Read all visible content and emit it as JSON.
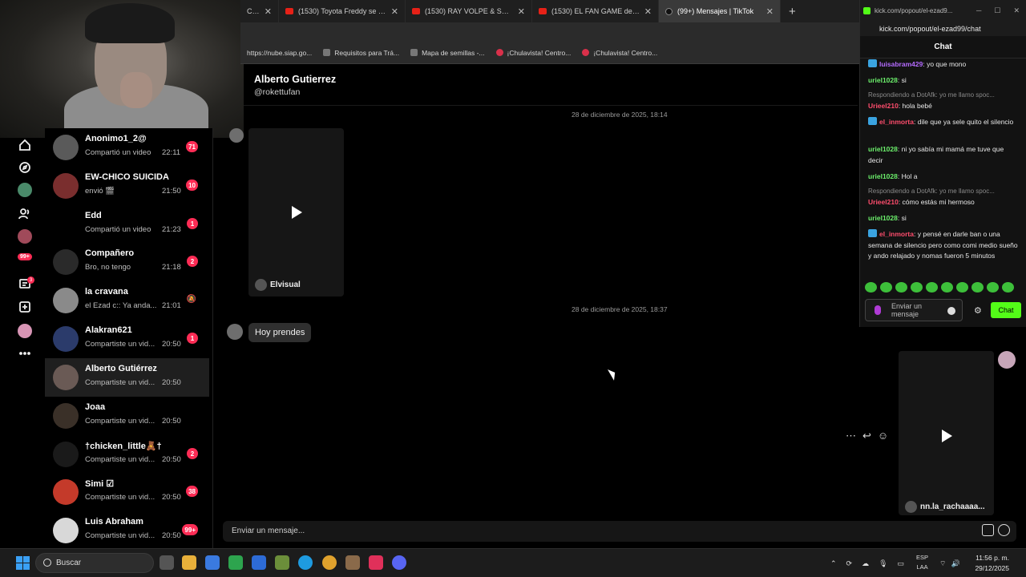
{
  "browser": {
    "tabs": [
      {
        "label": "C, B",
        "icon": "generic-tab-icon"
      },
      {
        "label": "(1530) Toyota Freddy se ríe mu",
        "icon": "youtube-icon"
      },
      {
        "label": "(1530) RAY VOLPE & SULLIVAN",
        "icon": "youtube-icon"
      },
      {
        "label": "(1530) EL FAN GAME de FNAF",
        "icon": "youtube-icon"
      },
      {
        "label": "(99+) Mensajes | TikTok",
        "icon": "tiktok-icon",
        "active": true
      }
    ],
    "new_tab": "+",
    "bookmarks": [
      "https://nube.siap.go...",
      "Requisitos para Trá...",
      "Mapa de semillas -...",
      "¡Chulavista! Centro...",
      "¡Chulavista! Centro..."
    ]
  },
  "rail": {
    "icons": [
      "home-icon",
      "explore-icon",
      "following-icon",
      "friends-icon",
      "profile-icon",
      "inbox-icon",
      "messages-icon",
      "upload-icon",
      "avatar-icon",
      "more-icon"
    ],
    "inbox_badge": "99+",
    "messages_badge": "3"
  },
  "conversations": [
    {
      "name": "Anonimo1_2@",
      "preview": "Compartió un video",
      "time": "22:11",
      "badge": "71",
      "avatar_color": "#5a5a5a"
    },
    {
      "name": "EW-CHICO SUICIDA",
      "preview": "envió 🎬",
      "time": "21:50",
      "badge": "10",
      "avatar_color": "#7a2e2e"
    },
    {
      "name": "Edd",
      "preview": "Compartió un video",
      "time": "21:23",
      "badge": "1",
      "avatar_color": "#000000"
    },
    {
      "name": "Compañero",
      "preview": "Bro, no tengo",
      "time": "21:18",
      "badge": "2",
      "avatar_color": "#2a2a2a"
    },
    {
      "name": "la cravana",
      "preview": "el Ezad c:: Ya anda...",
      "time": "21:01",
      "badge": "",
      "muted": true,
      "avatar_color": "#8a8a8a"
    },
    {
      "name": "Alakran621",
      "preview": "Compartiste un vid...",
      "time": "20:50",
      "badge": "1",
      "avatar_color": "#2b3b6b"
    },
    {
      "name": "Alberto Gutiérrez",
      "preview": "Compartiste un vid...",
      "time": "20:50",
      "badge": "",
      "selected": true,
      "avatar_color": "#6a5a55"
    },
    {
      "name": "Joaa",
      "preview": "Compartiste un vid...",
      "time": "20:50",
      "badge": "",
      "avatar_color": "#3a3028"
    },
    {
      "name": "†chicken_little🧸†",
      "preview": "Compartiste un vid...",
      "time": "20:50",
      "badge": "2",
      "avatar_color": "#1a1a1a"
    },
    {
      "name": "Simi ☑",
      "preview": "Compartiste un vid...",
      "time": "20:50",
      "badge": "38",
      "avatar_color": "#c43a2a"
    },
    {
      "name": "Luis Abraham",
      "preview": "Compartiste un vid...",
      "time": "20:50",
      "badge": "99+",
      "avatar_color": "#d8d8d8"
    }
  ],
  "chat": {
    "name": "Alberto Gutierrez",
    "handle": "@rokettufan",
    "date1": "28 de diciembre de 2025, 18:14",
    "video1_author": "Elvisual",
    "date2": "28 de diciembre de 2025, 18:37",
    "message": "Hoy prendes",
    "video2_author": "nn.la_rachaaaa...",
    "composer_placeholder": "Enviar un mensaje..."
  },
  "kick": {
    "window_title": "kick.com/popout/el-ezad9...",
    "url": "kick.com/popout/el-ezad99/chat",
    "header": "Chat",
    "messages": [
      {
        "user": "luisabram429",
        "color": "#b46bff",
        "badge": true,
        "text": "yo que mono"
      },
      {
        "user": "uriel1028",
        "color": "#6cf06c",
        "badge": false,
        "text": "si"
      },
      {
        "reply": "Respondiendo a DotAfk: yo me llamo spoc..."
      },
      {
        "user": "Urieel210",
        "color": "#ff4d6d",
        "badge": false,
        "text": "hola bebé"
      },
      {
        "user": "el_inmorta",
        "color": "#ff4d6d",
        "badge": true,
        "text": "dile que ya sele quito el silencio"
      },
      {
        "user": "uriel1028",
        "color": "#6cf06c",
        "badge": false,
        "text": "ni yo sabía mi mamá me tuve que decir"
      },
      {
        "user": "uriel1028",
        "color": "#6cf06c",
        "badge": false,
        "text": "Hol a"
      },
      {
        "reply": "Respondiendo a DotAfk: yo me llamo spoc..."
      },
      {
        "user": "Urieel210",
        "color": "#ff4d6d",
        "badge": false,
        "text": "cómo estás mi hermoso"
      },
      {
        "user": "uriel1028",
        "color": "#6cf06c",
        "badge": false,
        "text": "si"
      },
      {
        "user": "el_inmorta",
        "color": "#ff4d6d",
        "badge": true,
        "text": "y pensé en darle ban o una semana de silencio pero como comi medio sueño y ando relajado y nomas fueron 5 minutos"
      }
    ],
    "input_placeholder": "Enviar un mensaje",
    "send_label": "Chat"
  },
  "taskbar": {
    "search_label": "Buscar",
    "lang_top": "ESP",
    "lang_bottom": "LAA",
    "time": "11:56 p. m.",
    "date": "29/12/2025"
  }
}
